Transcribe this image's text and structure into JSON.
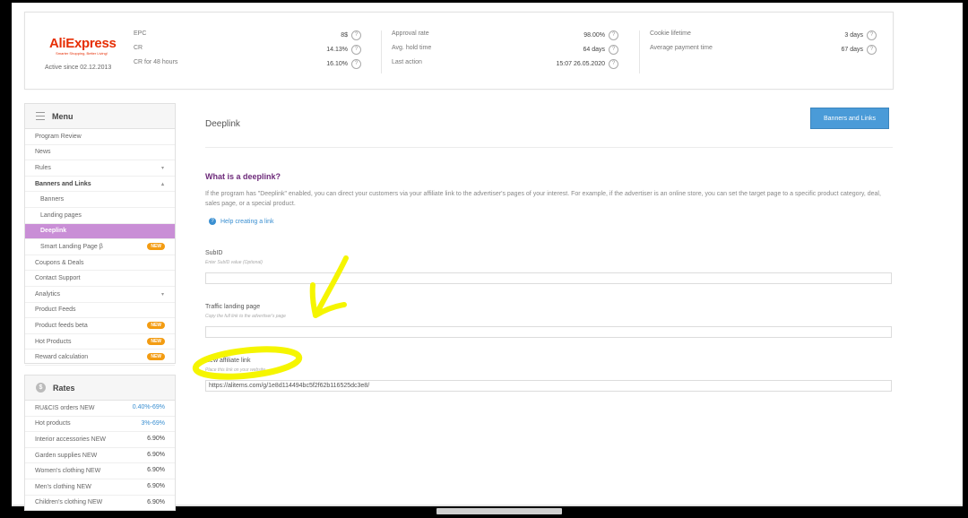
{
  "program": {
    "logo_text": "AliExpress",
    "logo_tagline": "Smarter Shopping, Better Living!",
    "active_since": "Active since 02.12.2013"
  },
  "stats": {
    "col1": [
      {
        "label": "EPC",
        "value": "8$"
      },
      {
        "label": "CR",
        "value": "14.13%"
      },
      {
        "label": "CR for 48 hours",
        "value": "16.10%"
      }
    ],
    "col2": [
      {
        "label": "Approval rate",
        "value": "98.00%"
      },
      {
        "label": "Avg. hold time",
        "value": "64 days"
      },
      {
        "label": "Last action",
        "value": "15:07 26.05.2020"
      }
    ],
    "col3": [
      {
        "label": "Cookie lifetime",
        "value": "3 days"
      },
      {
        "label": "Average payment time",
        "value": "67 days"
      }
    ],
    "help_glyph": "?"
  },
  "menu": {
    "title": "Menu",
    "items": [
      {
        "label": "Program Review"
      },
      {
        "label": "News"
      },
      {
        "label": "Rules",
        "caret": "▾"
      },
      {
        "label": "Banners and Links",
        "caret": "▴"
      },
      {
        "label": "Banners"
      },
      {
        "label": "Landing pages"
      },
      {
        "label": "Deeplink"
      },
      {
        "label": "Smart Landing Page β",
        "badge": "NEW"
      },
      {
        "label": "Coupons & Deals"
      },
      {
        "label": "Contact Support"
      },
      {
        "label": "Analytics",
        "caret": "▾"
      },
      {
        "label": "Product Feeds"
      },
      {
        "label": "Product feeds beta",
        "badge": "NEW"
      },
      {
        "label": "Hot Products",
        "badge": "NEW"
      },
      {
        "label": "Reward calculation",
        "badge": "NEW"
      }
    ]
  },
  "rates": {
    "title": "Rates",
    "icon_glyph": "$",
    "rows": [
      {
        "label": "RU&CIS orders NEW",
        "value": "0.40%-69%"
      },
      {
        "label": "Hot products",
        "value": "3%-69%"
      },
      {
        "label": "Interior accessories NEW",
        "value": "6.90%"
      },
      {
        "label": "Garden supplies NEW",
        "value": "6.90%"
      },
      {
        "label": "Women's clothing NEW",
        "value": "6.90%"
      },
      {
        "label": "Men's clothing NEW",
        "value": "6.90%"
      },
      {
        "label": "Children's clothing NEW",
        "value": "6.90%"
      }
    ]
  },
  "main": {
    "page_title": "Deeplink",
    "banners_button": "Banners and Links",
    "section_title": "What is a deeplink?",
    "description": "If the program has \"Deeplink\" enabled, you can direct your customers via your affiliate link to the advertiser's pages of your interest. For example, if the advertiser is an online store, you can set the target page to a specific product category, deal, sales page, or a special product.",
    "help_link": "Help creating a link",
    "help_link_glyph": "?",
    "subid": {
      "label": "SubID",
      "hint": "Enter SubID value (Optional)",
      "value": ""
    },
    "landing": {
      "label": "Traffic landing page",
      "hint": "Copy the full link to the advertiser's page",
      "value": ""
    },
    "affiliate": {
      "label": "New affiliate link",
      "hint": "Place this link on your website",
      "value": "https://alitems.com/g/1e8d114494bc5f2f62b116525dc3e8/"
    }
  },
  "annotation": {
    "color": "#f5f500"
  }
}
